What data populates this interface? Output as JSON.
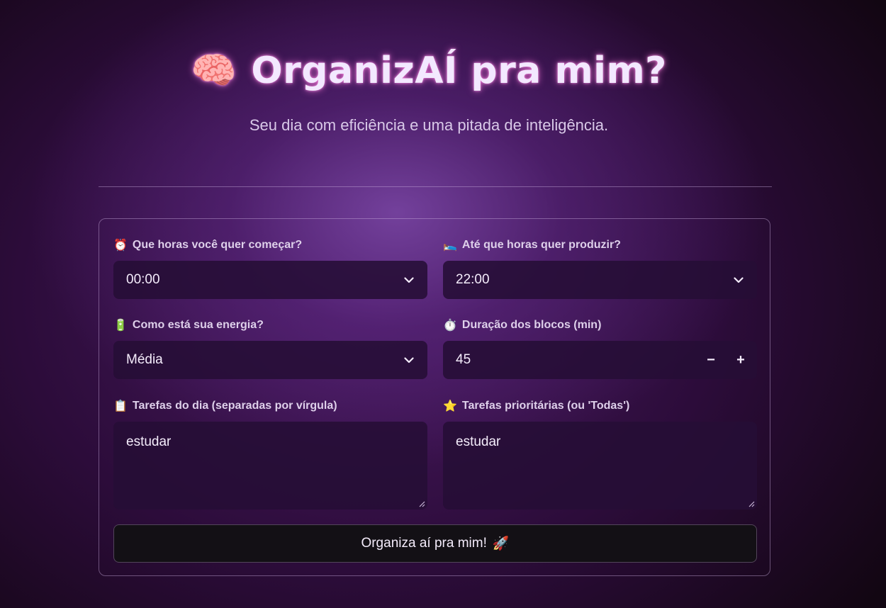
{
  "header": {
    "brain_icon": "🧠",
    "title": "OrganizAÍ pra mim?",
    "subtitle": "Seu dia com eficiência e uma pitada de inteligência."
  },
  "form": {
    "start_time": {
      "icon": "⏰",
      "label": "Que horas você quer começar?",
      "value": "00:00"
    },
    "end_time": {
      "icon": "🛌",
      "label": "Até que horas quer produzir?",
      "value": "22:00"
    },
    "energy": {
      "icon": "🔋",
      "label": "Como está sua energia?",
      "value": "Média"
    },
    "block_duration": {
      "icon": "⏱️",
      "label": "Duração dos blocos (min)",
      "value": "45",
      "decrement": "−",
      "increment": "+"
    },
    "tasks": {
      "icon": "📋",
      "label": "Tarefas do dia (separadas por vírgula)",
      "value": "estudar"
    },
    "priority_tasks": {
      "icon": "⭐",
      "label": "Tarefas prioritárias (ou 'Todas')",
      "value": "estudar"
    },
    "submit": {
      "label": "Organiza aí pra mim!",
      "icon": "🚀"
    }
  }
}
